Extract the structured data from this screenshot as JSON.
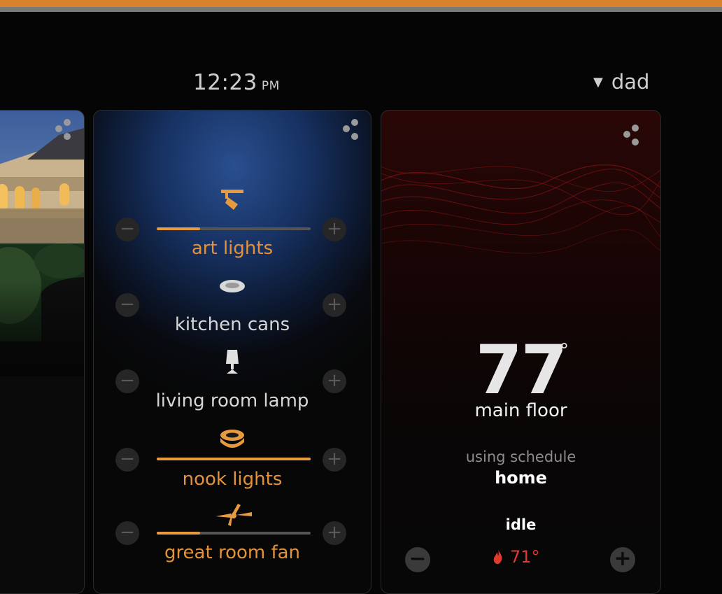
{
  "header": {
    "time": "12:23",
    "ampm": "PM",
    "user": "dad"
  },
  "lights": {
    "items": [
      {
        "label": "art lights",
        "icon": "track-light-icon",
        "on": true,
        "level": 0.28
      },
      {
        "label": "kitchen cans",
        "icon": "can-light-icon",
        "on": false,
        "level": null
      },
      {
        "label": "living room lamp",
        "icon": "lamp-icon",
        "on": false,
        "level": null
      },
      {
        "label": "nook lights",
        "icon": "ceiling-light-icon",
        "on": true,
        "level": 1.0
      },
      {
        "label": "great room fan",
        "icon": "ceiling-fan-icon",
        "on": true,
        "level": 0.28
      }
    ],
    "minus_glyph": "−",
    "plus_glyph": "+"
  },
  "thermostat": {
    "temperature": "77",
    "degree": "°",
    "zone": "main floor",
    "schedule_label": "using schedule",
    "schedule_name": "home",
    "status": "idle",
    "setpoint": "71°",
    "minus_glyph": "−",
    "plus_glyph": "+"
  },
  "colors": {
    "accent": "#e4923a",
    "heat": "#e03a2e"
  }
}
